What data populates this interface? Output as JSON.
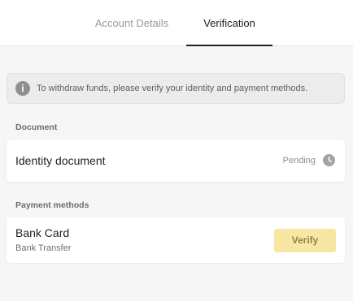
{
  "tabs": {
    "account_details": "Account Details",
    "verification": "Verification"
  },
  "banner": {
    "icon": "info-icon",
    "text": "To withdraw funds, please verify your identity and payment methods."
  },
  "document_section": {
    "label": "Document",
    "item": {
      "title": "Identity document",
      "status": "Pending",
      "status_icon": "clock-icon"
    }
  },
  "payment_section": {
    "label": "Payment methods",
    "item": {
      "title": "Bank Card",
      "subtitle": "Bank Transfer",
      "button_label": "Verify"
    }
  },
  "colors": {
    "background": "#f6f6f6",
    "card_background": "#ffffff",
    "banner_background": "#ececec",
    "active_tab": "#1f1f1f",
    "inactive_tab": "#9b9b9b",
    "verify_button_background": "#f8e7a2",
    "verify_button_text": "#8f8456",
    "status_icon": "#a3a3a3"
  }
}
